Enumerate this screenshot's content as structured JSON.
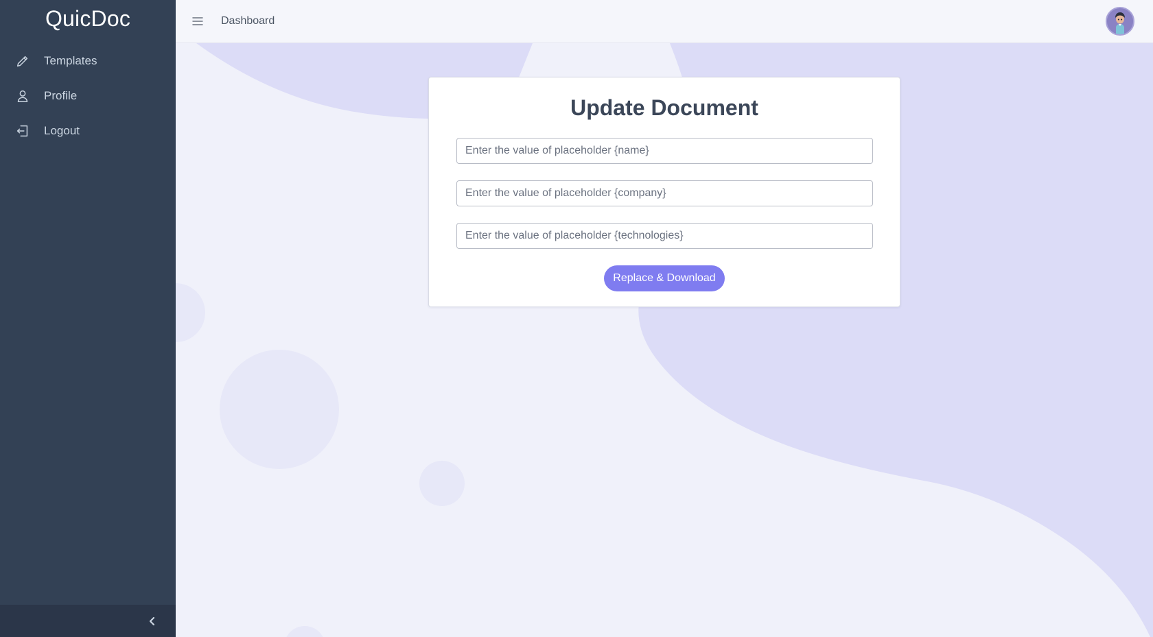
{
  "sidebar": {
    "brand": "QuicDoc",
    "items": [
      {
        "label": "Templates",
        "icon": "pencil-icon"
      },
      {
        "label": "Profile",
        "icon": "user-icon"
      },
      {
        "label": "Logout",
        "icon": "logout-icon"
      }
    ],
    "collapse_icon": "chevron-left-icon"
  },
  "header": {
    "title": "Dashboard",
    "menu_icon": "hamburger-menu-icon",
    "avatar_icon": "user-avatar"
  },
  "card": {
    "title": "Update Document",
    "fields": [
      {
        "placeholder": "Enter the value of placeholder {name}",
        "value": ""
      },
      {
        "placeholder": "Enter the value of placeholder {company}",
        "value": ""
      },
      {
        "placeholder": "Enter the value of placeholder {technologies}",
        "value": ""
      }
    ],
    "submit_label": "Replace & Download"
  },
  "colors": {
    "sidebar_bg": "#334155",
    "content_bg": "#f0f1fa",
    "blob": "#dcdcf7",
    "accent": "#7f7cf0",
    "title": "#3b4658"
  }
}
